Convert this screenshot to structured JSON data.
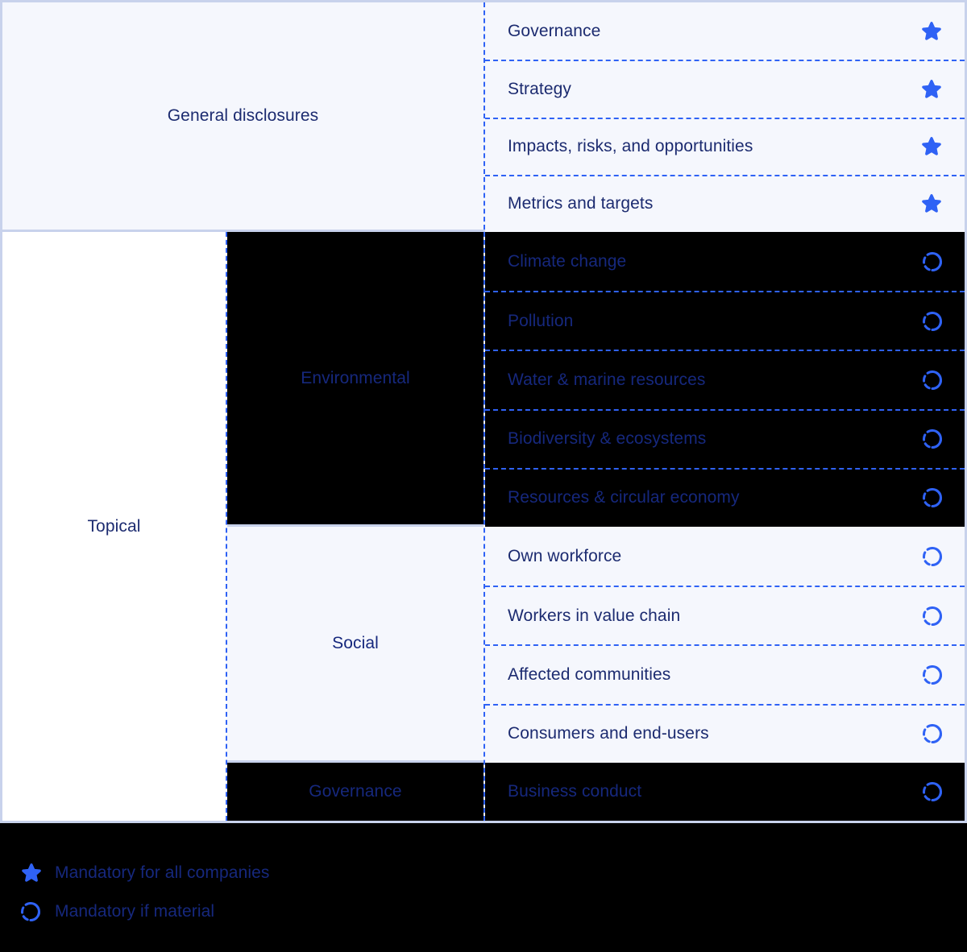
{
  "matrix": {
    "groups": [
      {
        "label": "General disclosures",
        "tone": "light",
        "topics": [
          {
            "label": "Governance",
            "icon": "star-icon",
            "icon_kind": "star",
            "tone": "light"
          },
          {
            "label": "Strategy",
            "icon": "star-icon",
            "icon_kind": "star",
            "tone": "light"
          },
          {
            "label": "Impacts, risks, and opportunities",
            "icon": "star-icon",
            "icon_kind": "star",
            "tone": "light"
          },
          {
            "label": "Metrics and targets",
            "icon": "star-icon",
            "icon_kind": "star",
            "tone": "light"
          }
        ]
      },
      {
        "label": "Topical",
        "tone": "white",
        "pillars": [
          {
            "label": "Environmental",
            "tone": "dark",
            "topics": [
              {
                "label": "Climate change",
                "icon": "dashed-circle-icon",
                "icon_kind": "circle",
                "tone": "dark"
              },
              {
                "label": "Pollution",
                "icon": "dashed-circle-icon",
                "icon_kind": "circle",
                "tone": "dark"
              },
              {
                "label": "Water & marine resources",
                "icon": "dashed-circle-icon",
                "icon_kind": "circle",
                "tone": "dark"
              },
              {
                "label": "Biodiversity & ecosystems",
                "icon": "dashed-circle-icon",
                "icon_kind": "circle",
                "tone": "dark"
              },
              {
                "label": "Resources & circular economy",
                "icon": "dashed-circle-icon",
                "icon_kind": "circle",
                "tone": "dark"
              }
            ]
          },
          {
            "label": "Social",
            "tone": "light",
            "topics": [
              {
                "label": "Own workforce",
                "icon": "dashed-circle-icon",
                "icon_kind": "circle",
                "tone": "light"
              },
              {
                "label": "Workers in value chain",
                "icon": "dashed-circle-icon",
                "icon_kind": "circle",
                "tone": "light"
              },
              {
                "label": "Affected communities",
                "icon": "dashed-circle-icon",
                "icon_kind": "circle",
                "tone": "light"
              },
              {
                "label": "Consumers and end-users",
                "icon": "dashed-circle-icon",
                "icon_kind": "circle",
                "tone": "light"
              }
            ]
          },
          {
            "label": "Governance",
            "tone": "dark",
            "topics": [
              {
                "label": "Business conduct",
                "icon": "dashed-circle-icon",
                "icon_kind": "circle",
                "tone": "dark"
              }
            ]
          }
        ]
      }
    ]
  },
  "legend": {
    "items": [
      {
        "icon": "star-icon",
        "icon_kind": "star",
        "label": "Mandatory for all companies"
      },
      {
        "icon": "dashed-circle-icon",
        "icon_kind": "circle",
        "label": "Mandatory if material"
      }
    ]
  },
  "colors": {
    "accent_blue": "#2f62f5",
    "navy_text": "#1c2b70",
    "navy_on_dark": "#16287d",
    "panel_light": "#f5f7fd",
    "panel_dark": "#000000",
    "border_blue_grey": "#c8d2ec"
  }
}
